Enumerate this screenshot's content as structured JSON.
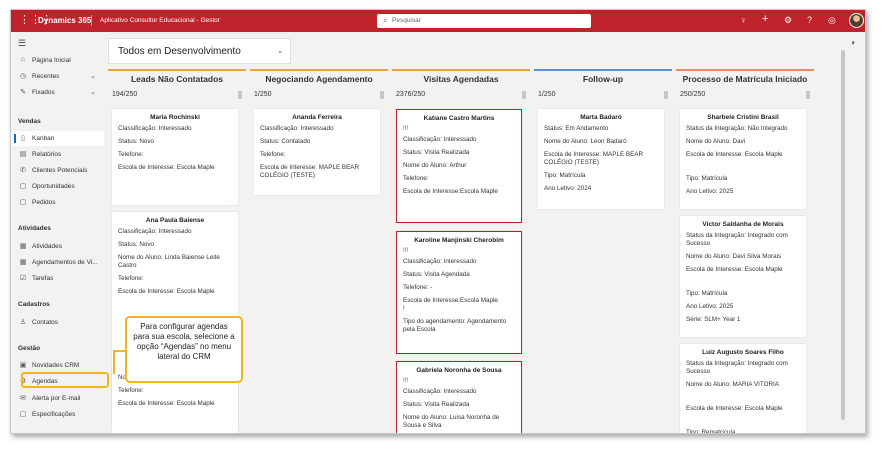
{
  "topbar": {
    "brand": "Dynamics 365",
    "app_name": "Aplicativo Consultor Educacional - Gestor",
    "search_placeholder": "Pesquisar"
  },
  "sidebar": {
    "top_items": [
      {
        "label": "Página Inicial",
        "icon": "home-icon"
      },
      {
        "label": "Recentes",
        "icon": "clock-icon"
      },
      {
        "label": "Fixados",
        "icon": "pin-icon"
      }
    ],
    "sections": [
      {
        "title": "Vendas",
        "items": [
          {
            "label": "Kanban",
            "icon": "kanban-icon"
          },
          {
            "label": "Relatórios",
            "icon": "report-icon"
          },
          {
            "label": "Clientes Potenciais",
            "icon": "phone-icon"
          },
          {
            "label": "Oportunidades",
            "icon": "document-icon"
          },
          {
            "label": "Pedidos",
            "icon": "document-icon"
          }
        ]
      },
      {
        "title": "Atividades",
        "items": [
          {
            "label": "Atividades",
            "icon": "calendar-icon"
          },
          {
            "label": "Agendamentos de Vi...",
            "icon": "calendar-icon"
          },
          {
            "label": "Tarefas",
            "icon": "task-icon"
          }
        ]
      },
      {
        "title": "Cadastros",
        "items": [
          {
            "label": "Contatos",
            "icon": "person-icon"
          }
        ]
      },
      {
        "title": "Gestão",
        "items": [
          {
            "label": "Novidades CRM",
            "icon": "news-icon"
          },
          {
            "label": "Agendas",
            "icon": "agenda-icon"
          },
          {
            "label": "Alerta por E-mail",
            "icon": "mail-icon"
          },
          {
            "label": "Especificações",
            "icon": "document-icon"
          }
        ]
      }
    ]
  },
  "view_selector": "Todos em Desenvolvimento",
  "colors": {
    "brand": "#c0222b",
    "accent": "#0f6cbd",
    "callout": "#f2b51a"
  },
  "columns": [
    {
      "title": "Leads Não Contatados",
      "count": "194/250",
      "bar_color": "#e8a33d",
      "cards": [
        {
          "name": "Maria Rochinski",
          "lines": [
            "Classificação: Interessado",
            "Status: Novo",
            "Telefone:",
            "Escola de Interesse: Escola Maple"
          ]
        },
        {
          "name": "Ana Paula Baiense",
          "lines": [
            "Classificação: Interessado",
            "Status: Novo",
            "Nome do Aluno: Linda Baiense Leite Castro",
            "Telefone:",
            "Escola de Interesse: Escola Maple"
          ]
        },
        {
          "name": "",
          "lines": [
            "Nome do Aluno: Gustavo Bahia",
            "Telefone:",
            "Escola de Interesse: Escola Maple"
          ]
        }
      ]
    },
    {
      "title": "Negociando Agendamento",
      "count": "1/250",
      "bar_color": "#e8a33d",
      "cards": [
        {
          "name": "Ananda Ferreira",
          "lines": [
            "Classificação: Interessado",
            "Status: Contatado",
            "Telefone:",
            "Escola de Interesse: MAPLE BEAR COLÉGIO (TESTE)"
          ]
        }
      ]
    },
    {
      "title": "Visitas Agendadas",
      "count": "2376/250",
      "bar_color": "#e8a33d",
      "cards": [
        {
          "name": "Katiane Castro Martins",
          "flag": "!!!",
          "lines": [
            "Classificação: Interessado",
            "Status: Visita Realizada",
            "Nome do Aluno: Arthur",
            "Telefone:",
            "Escola de Interesse:Escola Maple"
          ]
        },
        {
          "name": "Karoline Manjinski Cherobim",
          "flag": "!!!",
          "lines": [
            "Classificação: Interessado",
            "Status: Visita Agendada",
            "Telefone: -",
            "Escola de Interesse:Escola Maple\n!",
            "Tipo do agendamento: Agendamento pela Escola"
          ]
        },
        {
          "name": "Gabriela Noronha de Sousa",
          "flag": "!!!",
          "lines": [
            "Classificação: Interessado",
            "Status: Visita Realizada",
            "Nome do Aluno: Luisa Noronha de Sousa e Silva"
          ]
        }
      ]
    },
    {
      "title": "Follow-up",
      "count": "1/250",
      "bar_color": "#5b8fd6",
      "cards": [
        {
          "name": "Marta Badaró",
          "lines": [
            "Status: Em Andamento",
            "Nome do Aluno: Leon Badaró",
            "Escola de Interesse: MAPLE BEAR COLÉGIO (TESTE)",
            "Tipo: Matrícula",
            "Ano Letivo: 2024"
          ]
        }
      ]
    },
    {
      "title": "Processo de Matrícula Iniciado",
      "count": "250/250",
      "bar_color": "#e88a6a",
      "cards": [
        {
          "name": "Sharbele Cristini Brasil",
          "lines": [
            "Status da Integração: Não Integrado",
            "Nome do Aluno: Davi",
            "Escola de Interesse: Escola Maple",
            "",
            "Tipo: Matrícula",
            "Ano Letivo: 2025"
          ]
        },
        {
          "name": "Victor Saldanha de Morais",
          "lines": [
            "Status da Integração: Integrado com Sucesso",
            "Nome do Aluno: Davi Silva Morais",
            "Escola de Interesse: Escola Maple",
            "",
            "Tipo: Matrícula",
            "Ano Letivo: 2025",
            "Série: SLM+ Year 1"
          ]
        },
        {
          "name": "Luiz Augusto Soares Filho",
          "lines": [
            "Status da Integração: Integrado com Sucesso",
            "Nome do Aluno: MARIA VITORIA",
            "",
            "Escola de Interesse: Escola Maple",
            "",
            "Tipo: Rematrícula"
          ]
        }
      ]
    }
  ],
  "callout_text": "Para configurar agendas para sua escola, selecione a opção “Agendas” no menu lateral do CRM"
}
